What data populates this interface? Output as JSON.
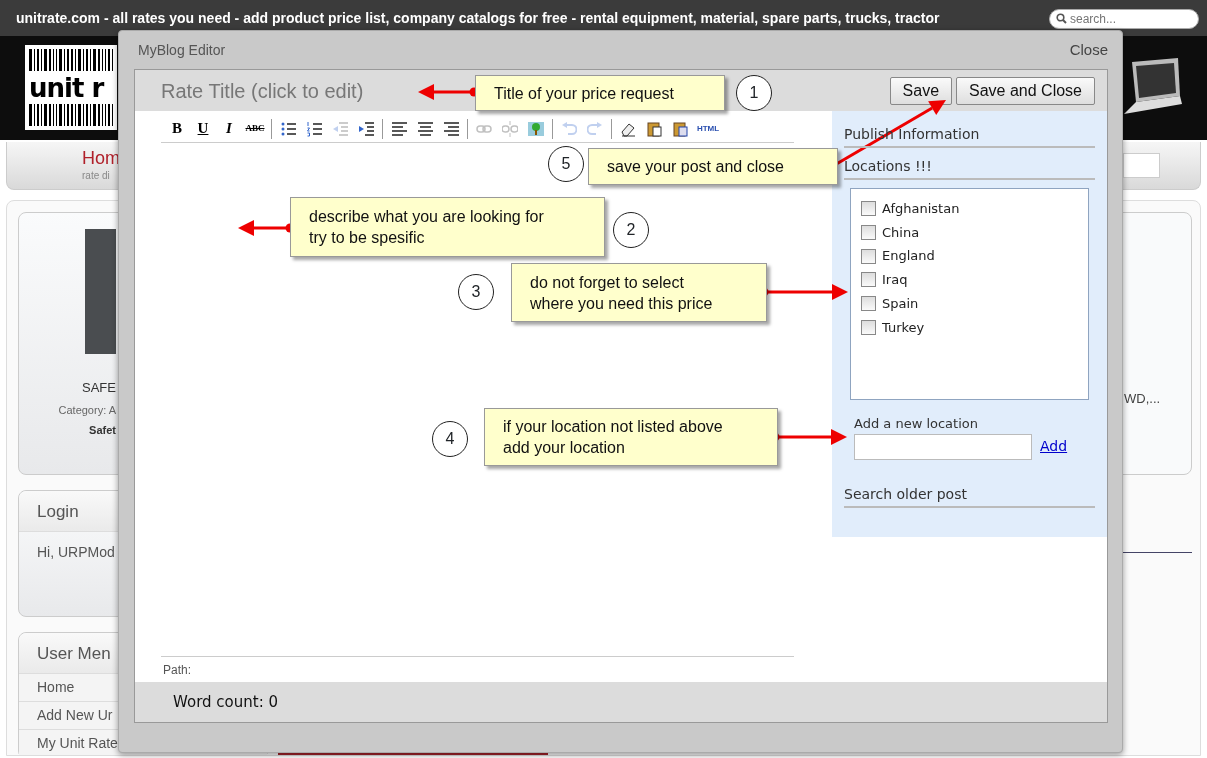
{
  "top_bar": {
    "title": "unitrate.com - all rates you need - add product price list, company catalogs for free - rental equipment, material, spare parts, trucks, tractor",
    "search": {
      "placeholder": "search..."
    }
  },
  "header": {
    "logo_text": "unit r"
  },
  "nav": {
    "items": [
      {
        "label": "Hom",
        "sublabel": "rate di"
      }
    ]
  },
  "background": {
    "product": {
      "name": "SAFE",
      "category": "Category: A",
      "line": "Safet"
    },
    "login": {
      "title": "Login",
      "greeting": "Hi, URPMod"
    },
    "user_menu": {
      "title": "User Men",
      "items": [
        "Home",
        "Add New Ur",
        "My Unit Rate"
      ]
    },
    "right_card": {
      "text": "WD,..."
    }
  },
  "editor": {
    "window_title": "MyBlog Editor",
    "close": "Close",
    "post_title": "Rate Title (click to edit)",
    "buttons": [
      "Save",
      "Save and Close"
    ],
    "toolbar": [
      [
        {
          "kind": "bold",
          "label": "B",
          "disabled": false
        },
        {
          "kind": "underline",
          "label": "U",
          "disabled": false
        },
        {
          "kind": "italic",
          "label": "I",
          "disabled": false
        },
        {
          "kind": "strikethrough",
          "label": "ABC",
          "disabled": false
        }
      ],
      [
        {
          "kind": "bullet-list",
          "disabled": false
        },
        {
          "kind": "numbered-list",
          "disabled": false
        },
        {
          "kind": "outdent",
          "disabled": true
        },
        {
          "kind": "indent",
          "disabled": false
        }
      ],
      [
        {
          "kind": "align-left",
          "disabled": false
        },
        {
          "kind": "align-center",
          "disabled": false
        },
        {
          "kind": "align-right",
          "disabled": false
        }
      ],
      [
        {
          "kind": "link",
          "disabled": true
        },
        {
          "kind": "unlink",
          "disabled": true
        },
        {
          "kind": "image",
          "disabled": false
        }
      ],
      [
        {
          "kind": "undo",
          "disabled": true
        },
        {
          "kind": "redo",
          "disabled": true
        }
      ],
      [
        {
          "kind": "eraser",
          "disabled": false
        },
        {
          "kind": "paste-text",
          "disabled": false
        },
        {
          "kind": "paste-word",
          "disabled": false
        },
        {
          "kind": "html",
          "label": "HTML",
          "disabled": false
        }
      ]
    ],
    "path_label": "Path:",
    "word_count": "Word count: 0",
    "sidebar": {
      "publish_heading": "Publish Information",
      "locations_heading": "Locations !!!",
      "locations": [
        {
          "label": "Afghanistan",
          "checked": false
        },
        {
          "label": "China",
          "checked": false
        },
        {
          "label": "England",
          "checked": false
        },
        {
          "label": "Iraq",
          "checked": false
        },
        {
          "label": "Spain",
          "checked": false
        },
        {
          "label": "Turkey",
          "checked": false
        }
      ],
      "new_location": {
        "label": "Add a new location",
        "add": "Add"
      },
      "search_heading": "Search older post"
    }
  },
  "callouts": [
    {
      "number": "1",
      "lines": [
        "Title of your price request"
      ]
    },
    {
      "number": "5",
      "lines": [
        "save your post and close"
      ]
    },
    {
      "number": "2",
      "lines": [
        "describe what you are looking for",
        "try to be spesific"
      ]
    },
    {
      "number": "3",
      "lines": [
        "do not forget to select",
        "where you need this price"
      ]
    },
    {
      "number": "4",
      "lines": [
        "if your location not listed above",
        "add your location"
      ]
    }
  ]
}
